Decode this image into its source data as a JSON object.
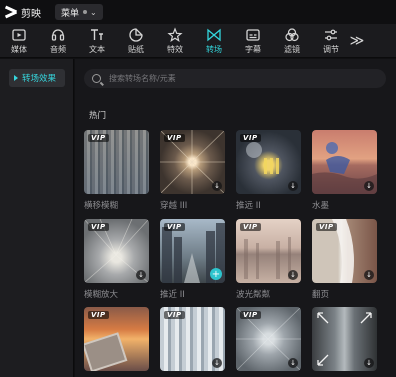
{
  "app": {
    "name": "剪映",
    "menu_label": "菜单"
  },
  "toolbar": {
    "items": [
      {
        "label": "媒体",
        "icon": "media-icon"
      },
      {
        "label": "音频",
        "icon": "audio-icon"
      },
      {
        "label": "文本",
        "icon": "text-icon"
      },
      {
        "label": "贴纸",
        "icon": "sticker-icon"
      },
      {
        "label": "特效",
        "icon": "effects-icon"
      },
      {
        "label": "转场",
        "icon": "transition-icon",
        "active": true
      },
      {
        "label": "字幕",
        "icon": "subtitle-icon"
      },
      {
        "label": "滤镜",
        "icon": "filter-icon"
      },
      {
        "label": "调节",
        "icon": "adjust-icon"
      }
    ],
    "more": "≫",
    "accent_color": "#33d6dc"
  },
  "sidebar": {
    "active_item": "转场效果"
  },
  "search": {
    "placeholder": "搜索转场名称/元素"
  },
  "section_title": "热门",
  "grid": [
    {
      "caption": "横移模糊",
      "vip": true,
      "badge": "none"
    },
    {
      "caption": "穿越 III",
      "vip": true,
      "badge": "download"
    },
    {
      "caption": "推远 II",
      "vip": true,
      "badge": "download"
    },
    {
      "caption": "水墨",
      "vip": false,
      "badge": "download"
    },
    {
      "caption": "模糊放大",
      "vip": true,
      "badge": "download"
    },
    {
      "caption": "推近 II",
      "vip": true,
      "badge": "add"
    },
    {
      "caption": "波光粼粼",
      "vip": true,
      "badge": "download"
    },
    {
      "caption": "翻页",
      "vip": true,
      "badge": "download"
    },
    {
      "caption": "",
      "vip": true,
      "badge": "none"
    },
    {
      "caption": "",
      "vip": true,
      "badge": "download"
    },
    {
      "caption": "",
      "vip": true,
      "badge": "download"
    },
    {
      "caption": "",
      "vip": false,
      "badge": "download"
    }
  ],
  "vip_label": "VIP",
  "download_glyph": "↓",
  "add_glyph": "+"
}
